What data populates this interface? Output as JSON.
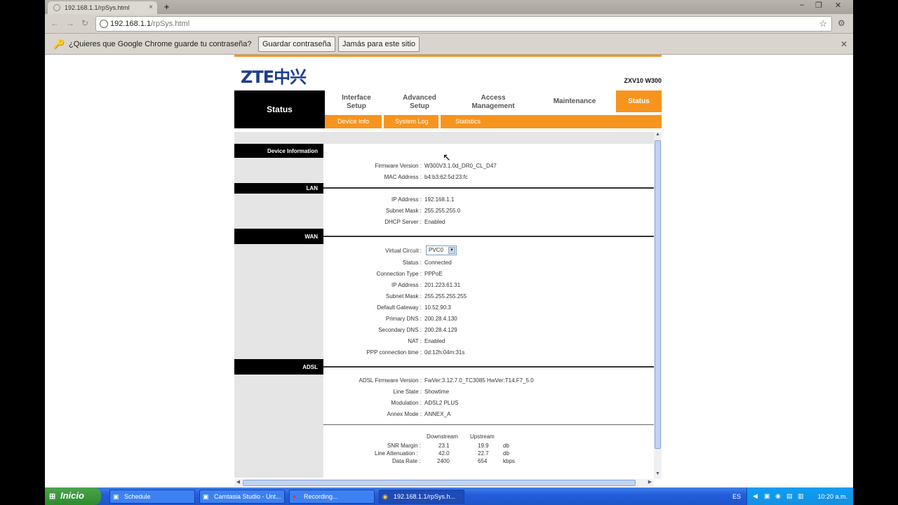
{
  "browser": {
    "tab_title": "192.168.1.1/rpSys.html",
    "tab_close": "×",
    "new_tab": "+",
    "url_host": "192.168.1.1",
    "url_path": "/rpSys.html",
    "minimize": "‒",
    "maximize": "❐",
    "close": "✕",
    "back": "←",
    "forward": "→",
    "reload": "↻",
    "star": "☆",
    "wrench": "⚙"
  },
  "infobar": {
    "message": "¿Quieres que Google Chrome guarde tu contraseña?",
    "save_label": "Guardar contraseña",
    "never_label": "Jamás para este sitio",
    "close": "✕",
    "key_icon": "🔑"
  },
  "router": {
    "logo": "ZTE中兴",
    "model": "ZXV10 W300",
    "current_section": "Status",
    "menu": [
      {
        "label": "Interface Setup"
      },
      {
        "label": "Advanced Setup"
      },
      {
        "label": "Access Management"
      },
      {
        "label": "Maintenance"
      },
      {
        "label": "Status"
      }
    ],
    "submenu": [
      "Device Info",
      "System Log",
      "Statistics"
    ],
    "sections": {
      "device": {
        "title": "Device Information",
        "firmware_label": "Firmware Version :",
        "firmware_value": "W300V3.1.0d_DR0_CL_D47",
        "mac_label": "MAC Address :",
        "mac_value": "b4:b3:62:5d:23:fc"
      },
      "lan": {
        "title": "LAN",
        "ip_label": "IP Address :",
        "ip_value": "192.168.1.1",
        "mask_label": "Subnet Mask :",
        "mask_value": "255.255.255.0",
        "dhcp_label": "DHCP Server :",
        "dhcp_value": "Enabled"
      },
      "wan": {
        "title": "WAN",
        "vc_label": "Virtual Circuit :",
        "vc_value": "PVC0",
        "status_label": "Status :",
        "status_value": "Connected",
        "conn_label": "Connection Type :",
        "conn_value": "PPPoE",
        "ip_label": "IP Address :",
        "ip_value": "201.223.61.31",
        "mask_label": "Subnet Mask :",
        "mask_value": "255.255.255.255",
        "gw_label": "Default Gateway :",
        "gw_value": "10.52.90.3",
        "pdns_label": "Primary DNS :",
        "pdns_value": "200.28.4.130",
        "sdns_label": "Secondary DNS :",
        "sdns_value": "200.28.4.129",
        "nat_label": "NAT :",
        "nat_value": "Enabled",
        "ppp_label": "PPP connection time :",
        "ppp_value": "0d:12h:04m:31s"
      },
      "adsl": {
        "title": "ADSL",
        "fw_label": "ADSL Firmware Version :",
        "fw_value": "FwVer:3.12.7.0_TC3085 HwVer:T14.F7_5.0",
        "line_label": "Line State :",
        "line_value": "Showtime",
        "mod_label": "Modulation :",
        "mod_value": "ADSL2 PLUS",
        "annex_label": "Annex Mode :",
        "annex_value": "ANNEX_A",
        "downstream": "Downstream",
        "upstream": "Upstream",
        "snr_label": "SNR Margin :",
        "snr_down": "23.1",
        "snr_up": "19.9",
        "snr_unit": "db",
        "att_label": "Line Attenuation :",
        "att_down": "42.0",
        "att_up": "22.7",
        "att_unit": "db",
        "rate_label": "Data Rate :",
        "rate_down": "2400",
        "rate_up": "654",
        "rate_unit": "kbps"
      }
    }
  },
  "taskbar": {
    "start": "Inicio",
    "start_icon": "⊞",
    "tasks": [
      {
        "label": "Schedule",
        "icon": "▣"
      },
      {
        "label": "Camtasia Studio - Unt...",
        "icon": "▣"
      },
      {
        "label": "Recording...",
        "icon": "●"
      },
      {
        "label": "192.168.1.1/rpSys.h...",
        "icon": "◉"
      }
    ],
    "lang": "ES",
    "clock": "10:20 a.m."
  }
}
